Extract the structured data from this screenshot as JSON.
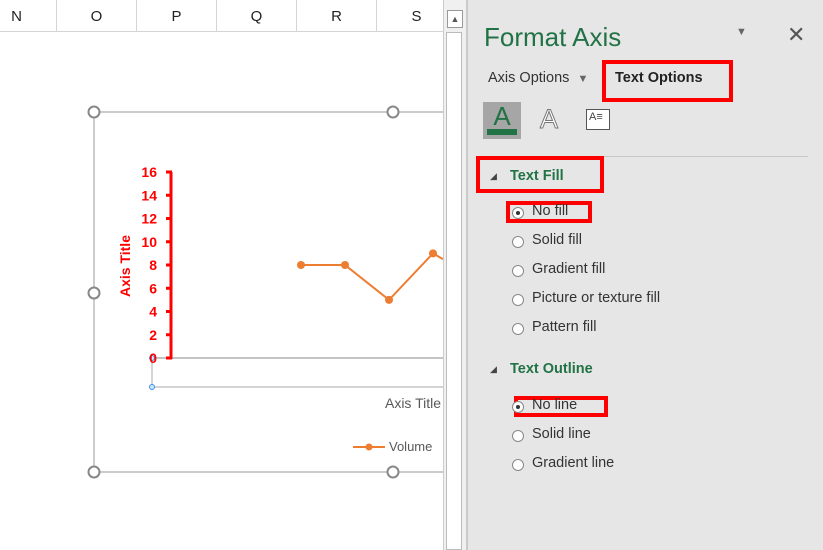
{
  "columns": [
    "N",
    "O",
    "P",
    "Q",
    "R",
    "S"
  ],
  "chart": {
    "chart_data": {
      "type": "line",
      "series": [
        {
          "name": "Volume",
          "values": [
            8,
            8,
            5,
            9
          ]
        }
      ],
      "ylim": [
        0,
        16
      ],
      "yticks": [
        "0",
        "2",
        "4",
        "6",
        "8",
        "10",
        "12",
        "14",
        "16"
      ],
      "ylabel": "Axis Title",
      "xlabel": "Axis Title",
      "axis_color": "#ff0000",
      "series_color": "#ed7d31",
      "legend": "bottom"
    }
  },
  "panel": {
    "title": "Format Axis",
    "tabs": [
      {
        "label": "Axis Options"
      },
      {
        "label": "Text Options"
      }
    ],
    "icons": [
      "text-fill-outline-icon",
      "text-effects-icon",
      "textbox-icon"
    ],
    "text_fill": {
      "label": "Text Fill",
      "options": [
        "No fill",
        "Solid fill",
        "Gradient fill",
        "Picture or texture fill",
        "Pattern fill"
      ],
      "selected": "No fill"
    },
    "text_outline": {
      "label": "Text Outline",
      "options": [
        "No line",
        "Solid line",
        "Gradient line"
      ],
      "selected": "No line"
    },
    "accent": "#217346"
  }
}
